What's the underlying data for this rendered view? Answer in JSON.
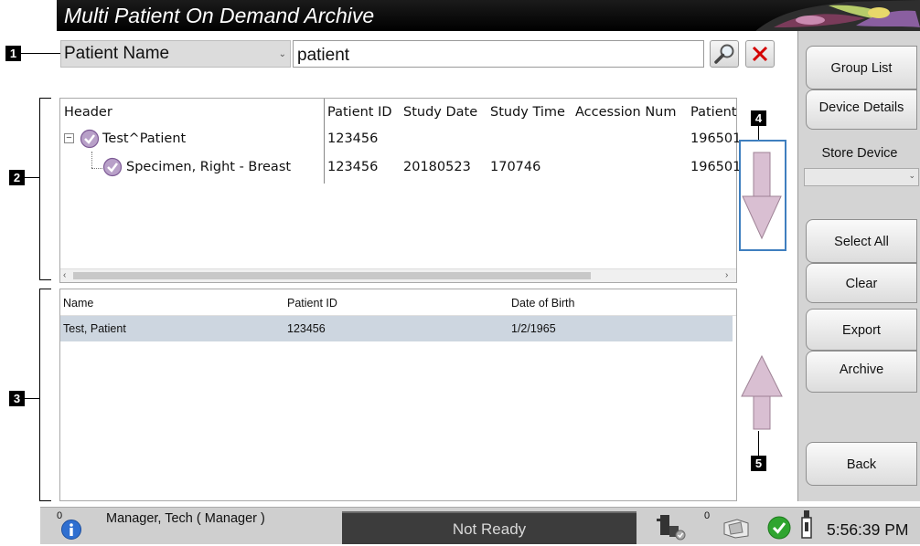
{
  "app": {
    "title": "Multi Patient On Demand Archive"
  },
  "search": {
    "type_selected": "Patient Name",
    "value": "patient",
    "search_icon": "magnifier-icon",
    "clear_icon": "red-x-icon"
  },
  "callouts": [
    "1",
    "2",
    "3",
    "4",
    "5"
  ],
  "tree": {
    "columns": [
      "Header",
      "Patient ID",
      "Study Date",
      "Study Time",
      "Accession Num",
      "Patient"
    ],
    "rows": [
      {
        "header": "Test^Patient",
        "patient_id": "123456",
        "study_date": "",
        "study_time": "",
        "accession": "",
        "patient": "196501"
      },
      {
        "header": "Specimen, Right - Breast",
        "patient_id": "123456",
        "study_date": "20180523",
        "study_time": "170746",
        "accession": "",
        "patient": "196501"
      }
    ]
  },
  "list": {
    "columns": [
      "Name",
      "Patient ID",
      "Date of Birth"
    ],
    "rows": [
      {
        "name": "Test, Patient",
        "patient_id": "123456",
        "dob": "1/2/1965"
      }
    ]
  },
  "sidebar": {
    "group_list": "Group List",
    "device_details": "Device Details",
    "store_device_label": "Store Device",
    "store_device_value": "",
    "select_all": "Select All",
    "clear": "Clear",
    "export": "Export",
    "archive": "Archive",
    "back": "Back"
  },
  "status": {
    "left_count": "0",
    "user": "Manager, Tech ( Manager )",
    "state": "Not Ready",
    "right_count": "0",
    "time": "5:56:39 PM"
  },
  "colors": {
    "titlebar": "#000000",
    "selected_row": "#cdd6e0",
    "arrow_fill": "#d9bfd2",
    "focus_border": "#3f7fbf",
    "clear_red": "#d40000",
    "ok_green": "#2fa52f"
  }
}
